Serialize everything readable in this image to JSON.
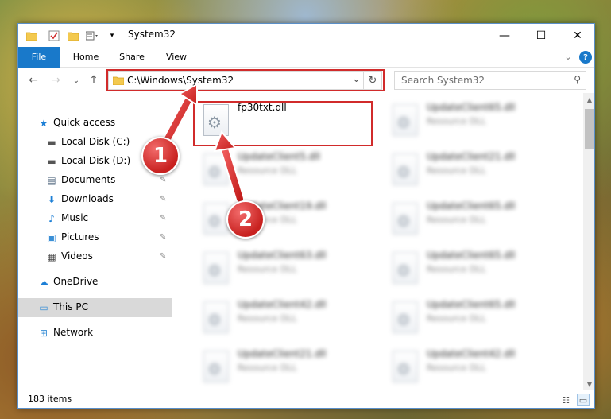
{
  "window": {
    "title": "System32",
    "controls": {
      "minimize": "—",
      "maximize": "☐",
      "close": "✕"
    }
  },
  "ribbon": {
    "tabs": [
      "File",
      "Home",
      "Share",
      "View"
    ],
    "collapse_glyph": "⌄",
    "help_glyph": "?"
  },
  "address_bar": {
    "path": "C:\\Windows\\System32",
    "dropdown_glyph": "⌄",
    "refresh_glyph": "↻"
  },
  "search": {
    "placeholder": "Search System32",
    "icon_glyph": "⚲"
  },
  "navigation": {
    "back": "←",
    "forward": "→",
    "recent": "⌄",
    "up": "↑"
  },
  "sidebar": {
    "items": [
      {
        "label": "Quick access",
        "icon": "star-icon",
        "glyph": "★",
        "color": "#1c7fd6",
        "pinned": false
      },
      {
        "label": "Local Disk (C:)",
        "icon": "drive-icon",
        "glyph": "▬",
        "color": "#555555",
        "pinned": true
      },
      {
        "label": "Local Disk (D:)",
        "icon": "drive-icon",
        "glyph": "▬",
        "color": "#555555",
        "pinned": true
      },
      {
        "label": "Documents",
        "icon": "documents-icon",
        "glyph": "▤",
        "color": "#5a6f86",
        "pinned": true
      },
      {
        "label": "Downloads",
        "icon": "downloads-icon",
        "glyph": "⬇",
        "color": "#1c7fd6",
        "pinned": true
      },
      {
        "label": "Music",
        "icon": "music-icon",
        "glyph": "♪",
        "color": "#1c7fd6",
        "pinned": true
      },
      {
        "label": "Pictures",
        "icon": "pictures-icon",
        "glyph": "▣",
        "color": "#3a8fd6",
        "pinned": true
      },
      {
        "label": "Videos",
        "icon": "videos-icon",
        "glyph": "▦",
        "color": "#444444",
        "pinned": true
      },
      {
        "label": "OneDrive",
        "icon": "onedrive-icon",
        "glyph": "☁",
        "color": "#1c7fd6",
        "pinned": false
      },
      {
        "label": "This PC",
        "icon": "computer-icon",
        "glyph": "▭",
        "color": "#3a8fd6",
        "pinned": false,
        "selected": true
      },
      {
        "label": "Network",
        "icon": "network-icon",
        "glyph": "⊞",
        "color": "#3a8fd6",
        "pinned": false
      }
    ],
    "pin_glyph": "✎"
  },
  "files": [
    {
      "name": "fp30txt.dll",
      "type": "",
      "blurred": false
    },
    {
      "name": "UpdateClient65.dll",
      "type": "Resource DLL",
      "blurred": true
    },
    {
      "name": "UpdateClient5.dll",
      "type": "Resource DLL",
      "blurred": true
    },
    {
      "name": "UpdateClient21.dll",
      "type": "Resource DLL",
      "blurred": true
    },
    {
      "name": "UpdateClient19.dll",
      "type": "Resource DLL",
      "blurred": true
    },
    {
      "name": "UpdateClient65.dll",
      "type": "Resource DLL",
      "blurred": true
    },
    {
      "name": "UpdateClient63.dll",
      "type": "Resource DLL",
      "blurred": true
    },
    {
      "name": "UpdateClient65.dll",
      "type": "Resource DLL",
      "blurred": true
    },
    {
      "name": "UpdateClient42.dll",
      "type": "Resource DLL",
      "blurred": true
    },
    {
      "name": "UpdateClient65.dll",
      "type": "Resource DLL",
      "blurred": true
    },
    {
      "name": "UpdateClient21.dll",
      "type": "Resource DLL",
      "blurred": true
    },
    {
      "name": "UpdateClient42.dll",
      "type": "Resource DLL",
      "blurred": true
    }
  ],
  "status_bar": {
    "item_count": "183 items"
  },
  "annotations": {
    "callouts": [
      "1",
      "2"
    ],
    "accent_color": "#d12b2b"
  }
}
